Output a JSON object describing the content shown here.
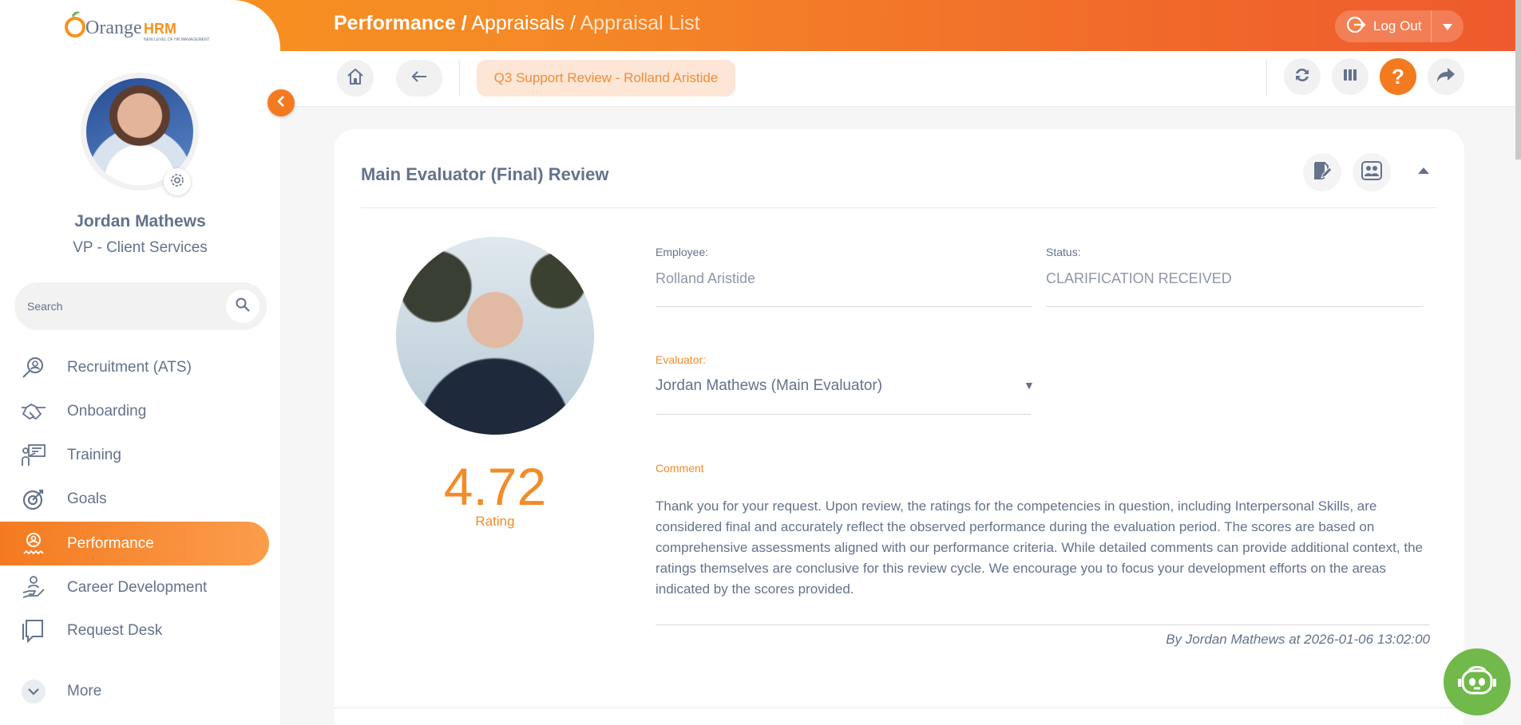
{
  "brand": {
    "logo_text_orange": "Orange",
    "logo_text_hrm": "HRM",
    "tagline": "NEW LEVEL OF HR MANAGEMENT"
  },
  "breadcrumb": {
    "module": "Performance /",
    "section": " Appraisals /",
    "page": " Appraisal List"
  },
  "header": {
    "logout_label": "Log Out"
  },
  "toolbar": {
    "tab_label": "Q3 Support Review - Rolland Aristide"
  },
  "user": {
    "name": "Jordan Mathews",
    "role": "VP - Client Services"
  },
  "search": {
    "placeholder": "Search"
  },
  "nav": [
    {
      "label": "Recruitment (ATS)",
      "icon": "recruitment-icon"
    },
    {
      "label": "Onboarding",
      "icon": "handshake-icon"
    },
    {
      "label": "Training",
      "icon": "training-icon"
    },
    {
      "label": "Goals",
      "icon": "target-icon"
    },
    {
      "label": "Performance",
      "icon": "award-icon",
      "active": true
    },
    {
      "label": "Career Development",
      "icon": "career-icon"
    },
    {
      "label": "Request Desk",
      "icon": "request-icon"
    },
    {
      "label": "More",
      "icon": "chevron-down-icon"
    }
  ],
  "review": {
    "title": "Main Evaluator (Final) Review",
    "rating_value": "4.72",
    "rating_label": "Rating",
    "employee_label": "Employee:",
    "employee_value": "Rolland Aristide",
    "status_label": "Status:",
    "status_value": "CLARIFICATION RECEIVED",
    "evaluator_label": "Evaluator:",
    "evaluator_value": "Jordan Mathews (Main Evaluator)",
    "comment_label": "Comment",
    "comment_text": "Thank you for your request. Upon review, the ratings for the competencies in question, including Interpersonal Skills, are considered final and accurately reflect the observed performance during the evaluation period. The scores are based on comprehensive assessments aligned with our performance criteria. While detailed comments can provide additional context, the ratings themselves are conclusive for this review cycle. We encourage you to focus your development efforts on the areas indicated by the scores provided.",
    "byline": "By Jordan Mathews at 2026-01-06 13:02:00"
  },
  "colors": {
    "accent": "#f47a20",
    "header_start": "#f7931e",
    "header_end": "#ee5a2d",
    "bot": "#70b94a",
    "text": "#64728c"
  }
}
